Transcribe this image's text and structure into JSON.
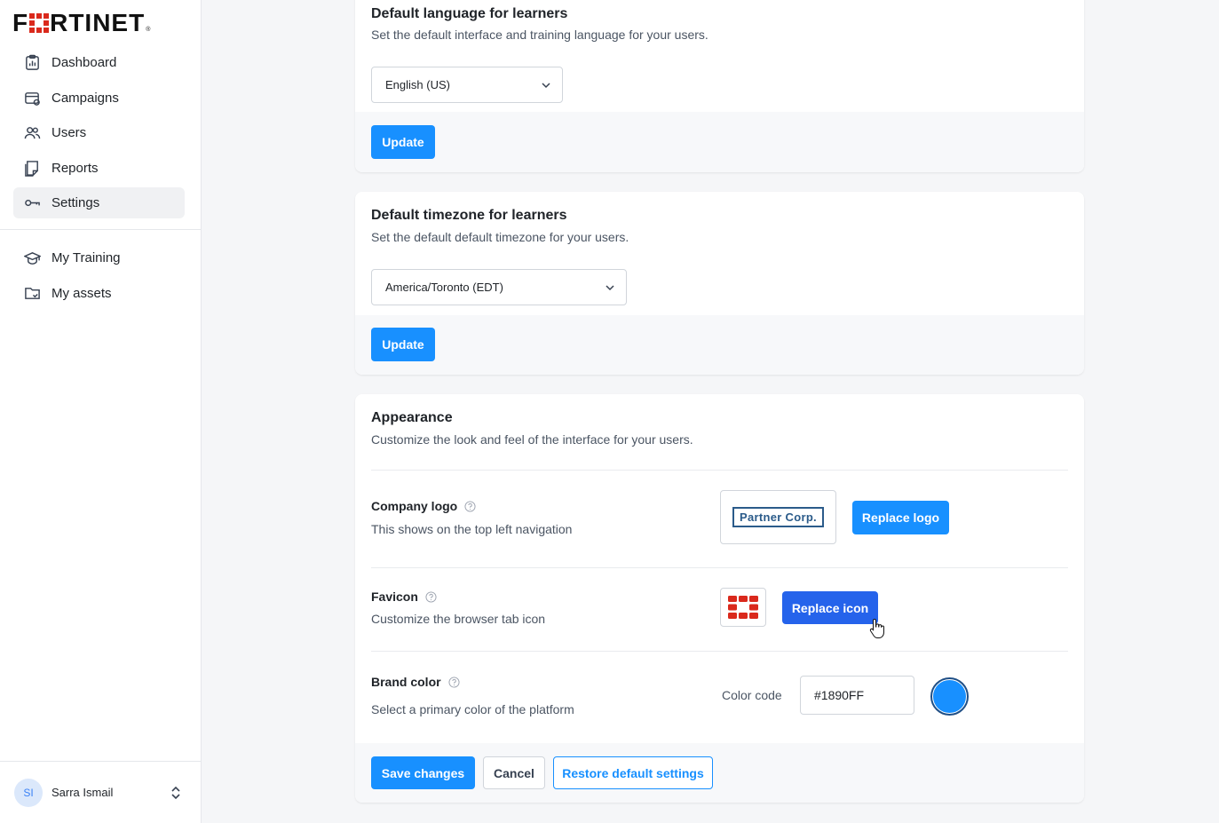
{
  "brand": {
    "logo_text_prefix": "F",
    "logo_text_suffix": "RTINET",
    "logo_reg": "®",
    "accent": "#1890ff",
    "logo_red": "#da291c"
  },
  "sidebar": {
    "items": [
      {
        "label": "Dashboard",
        "icon": "dashboard-icon"
      },
      {
        "label": "Campaigns",
        "icon": "campaigns-icon"
      },
      {
        "label": "Users",
        "icon": "users-icon"
      },
      {
        "label": "Reports",
        "icon": "reports-icon"
      },
      {
        "label": "Settings",
        "icon": "settings-key-icon",
        "active": true
      }
    ],
    "secondary_items": [
      {
        "label": "My Training",
        "icon": "graduation-cap-icon"
      },
      {
        "label": "My assets",
        "icon": "folder-icon"
      }
    ],
    "user": {
      "initials": "SI",
      "name": "Sarra Ismail"
    }
  },
  "language_card": {
    "title": "Default language for learners",
    "subtitle": "Set the default interface and training language for your users.",
    "selected": "English (US)",
    "update_label": "Update"
  },
  "timezone_card": {
    "title": "Default timezone for learners",
    "subtitle": "Set the default default timezone for your users.",
    "selected": "America/Toronto (EDT)",
    "update_label": "Update"
  },
  "appearance_card": {
    "title": "Appearance",
    "subtitle": "Customize the look and feel of the interface for your users.",
    "company_logo": {
      "label": "Company logo",
      "description": "This shows on the top left navigation",
      "preview_text": "Partner Corp.",
      "button_label": "Replace logo"
    },
    "favicon": {
      "label": "Favicon",
      "description": "Customize the browser tab icon",
      "button_label": "Replace icon"
    },
    "brand_color": {
      "label": "Brand color",
      "description": "Select a primary color of the platform",
      "color_code_label": "Color code",
      "value": "#1890FF",
      "swatch_color": "#1890ff"
    },
    "save_label": "Save changes",
    "cancel_label": "Cancel",
    "restore_label": "Restore default settings"
  }
}
